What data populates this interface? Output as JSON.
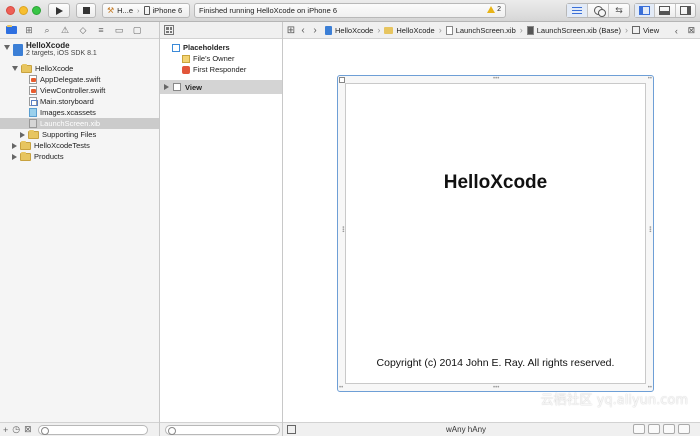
{
  "toolbar": {
    "scheme_name": "H...e",
    "device": "iPhone 6",
    "activity_text": "Finished running HelloXcode on iPhone 6",
    "warning_count": "2"
  },
  "navigator": {
    "project_name": "HelloXcode",
    "project_subtitle": "2 targets, iOS SDK 8.1",
    "items": [
      {
        "label": "HelloXcode"
      },
      {
        "label": "AppDelegate.swift"
      },
      {
        "label": "ViewController.swift"
      },
      {
        "label": "Main.storyboard"
      },
      {
        "label": "Images.xcassets"
      },
      {
        "label": "LaunchScreen.xib"
      },
      {
        "label": "Supporting Files"
      },
      {
        "label": "HelloXcodeTests"
      },
      {
        "label": "Products"
      }
    ]
  },
  "outline": {
    "placeholders_label": "Placeholders",
    "files_owner": "File's Owner",
    "first_responder": "First Responder",
    "view_label": "View"
  },
  "jumpbar": {
    "crumbs": [
      "HelloXcode",
      "HelloXcode",
      "LaunchScreen.xib",
      "LaunchScreen.xib (Base)",
      "View"
    ]
  },
  "canvas": {
    "title_text": "HelloXcode",
    "copyright_text": "Copyright (c) 2014 John E. Ray. All rights reserved."
  },
  "editor_footer": {
    "width_class": "wAny",
    "height_class": "hAny"
  },
  "watermark": "云栖社区 yq.aliyun.com"
}
